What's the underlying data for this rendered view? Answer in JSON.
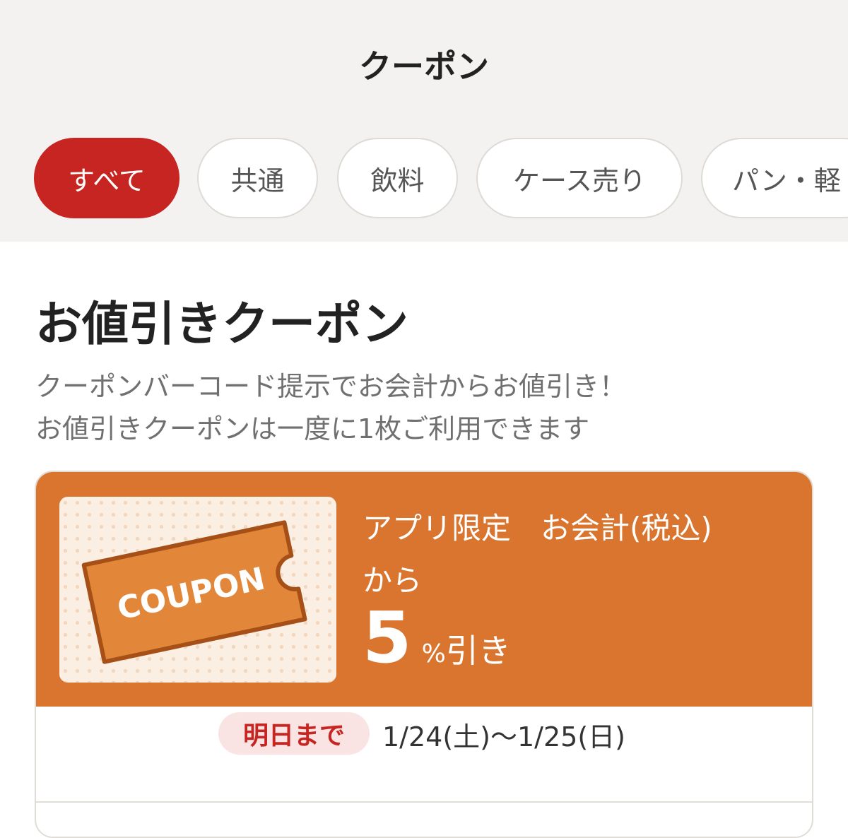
{
  "header": {
    "title": "クーポン"
  },
  "tabs": [
    {
      "label": "すべて",
      "active": true
    },
    {
      "label": "共通",
      "active": false
    },
    {
      "label": "飲料",
      "active": false
    },
    {
      "label": "ケース売り",
      "active": false
    },
    {
      "label": "パン・軽",
      "active": false
    }
  ],
  "section": {
    "title": "お値引きクーポン",
    "description_line1": "クーポンバーコード提示でお会計からお値引き！",
    "description_line2": "お値引きクーポンは一度に1枚ご利用できます"
  },
  "coupon": {
    "image_label": "COUPON",
    "offer_line1": "アプリ限定　お会計(税込)",
    "offer_line2": "から",
    "discount_value": "5",
    "discount_unit": "%",
    "discount_suffix": "引き",
    "deadline_badge": "明日まで",
    "date_range": "1/24(土)〜1/25(日)"
  },
  "colors": {
    "accent_red": "#c72522",
    "coupon_orange": "#d9752e",
    "background_gray": "#f3f2f0"
  }
}
